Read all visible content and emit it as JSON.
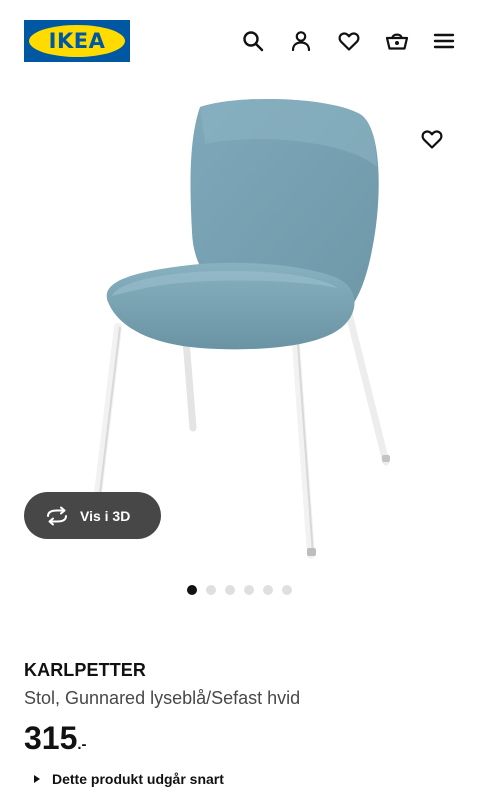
{
  "header": {
    "logo_text": "IKEA",
    "icons": [
      "search-icon",
      "account-icon",
      "favourites-heart-icon",
      "shopping-bag-icon",
      "menu-icon"
    ]
  },
  "product": {
    "name": "KARLPETTER",
    "description": "Stol, Gunnared lyseblå/Sefast hvid",
    "price_integer": "315",
    "price_suffix": ".-",
    "notice": "Dette produkt udgår snart",
    "seat_color": "#7ca6b6",
    "leg_color": "#f2f2f2"
  },
  "gallery": {
    "view_3d_label": "Vis i 3D",
    "image_count": 6,
    "active_index": 0
  },
  "colors": {
    "brand_blue": "#0058a3",
    "brand_yellow": "#ffdb00",
    "button_dark": "#474747"
  }
}
